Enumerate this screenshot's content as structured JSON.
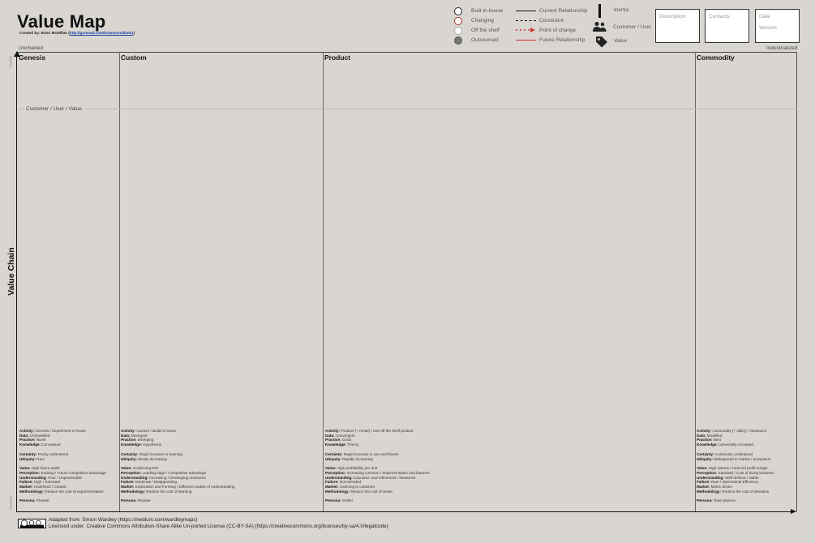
{
  "header": {
    "title": "Value Map",
    "created_by": "Created by: Brian McMillan (",
    "created_link": "http://gonmad.com/brianmcmillan01",
    "created_close": ")"
  },
  "legend": {
    "components": [
      "Built in-house",
      "Changing",
      "Off the shelf",
      "Outsourced"
    ],
    "relationships": [
      "Current Relationship",
      "Constraint",
      "Point of change",
      "Future Relationship"
    ],
    "symbols": [
      "Inertia",
      "Customer / User",
      "Value"
    ]
  },
  "boxes": [
    "Description",
    "Contacts",
    "Date",
    "Version"
  ],
  "evolution": {
    "left": "Uncharted",
    "right": "Industrialized"
  },
  "columns": [
    "Genesis",
    "Custom",
    "Product",
    "Commodity"
  ],
  "axis": {
    "y_label": "Value Chain",
    "visible": "Visible",
    "invisible": "Invisible"
  },
  "customer_line": "Customer / User / Value",
  "column_descriptions": [
    {
      "rows": [
        {
          "k": "Activity:",
          "v": "Genesis / Experiment in house"
        },
        {
          "k": "Data:",
          "v": "Unmodelled"
        },
        {
          "k": "Practice:",
          "v": "Novel"
        },
        {
          "k": "Knowledge:",
          "v": "Conceptual"
        },
        {
          "gap": true
        },
        {
          "k": "Certainty:",
          "v": "Poorly understood"
        },
        {
          "k": "Ubiquity:",
          "v": "Rare"
        },
        {
          "gap": true
        },
        {
          "k": "Value:",
          "v": "High future worth"
        },
        {
          "k": "Perception:",
          "v": "Exciting / Future competitive advantage"
        },
        {
          "k": "Understanding:",
          "v": "Poor / Unpredictable"
        },
        {
          "k": "Failure:",
          "v": "High / Tolerated"
        },
        {
          "k": "Market:",
          "v": "Undefined / Chaotic"
        },
        {
          "k": "Methodology:",
          "v": "Reduce the cost of experimentation"
        },
        {
          "gap": true
        },
        {
          "k": "Persona:",
          "v": "Pioneer"
        }
      ]
    },
    {
      "rows": [
        {
          "k": "Activity:",
          "v": "Custom / Build in house"
        },
        {
          "k": "Data:",
          "v": "Divergent"
        },
        {
          "k": "Practice:",
          "v": "Emerging"
        },
        {
          "k": "Knowledge:",
          "v": "Hypothesis"
        },
        {
          "gap": true
        },
        {
          "k": "Certainty:",
          "v": "Rapid increase in learning"
        },
        {
          "k": "Ubiquity:",
          "v": "Slowly increasing"
        },
        {
          "gap": true
        },
        {
          "k": "Value:",
          "v": "Confirming ROI"
        },
        {
          "k": "Perception:",
          "v": "Leading edge / Competitive advantage"
        },
        {
          "k": "Understanding:",
          "v": "Increasing / Developing measures"
        },
        {
          "k": "Failure:",
          "v": "Moderate / Disappointing"
        },
        {
          "k": "Market:",
          "v": "Exploration and Forming / Different models of understanding"
        },
        {
          "k": "Methodology:",
          "v": "Reduce the cost of learning"
        },
        {
          "gap": true
        },
        {
          "k": "Persona:",
          "v": "Pioneer"
        }
      ]
    },
    {
      "rows": [
        {
          "k": "Activity:",
          "v": "Product (+ rental) / Use off the shelf product"
        },
        {
          "k": "Data:",
          "v": "Convergent"
        },
        {
          "k": "Practice:",
          "v": "Good"
        },
        {
          "k": "Knowledge:",
          "v": "Theory"
        },
        {
          "gap": true
        },
        {
          "k": "Certainty:",
          "v": "Rapid increase in use and fitness"
        },
        {
          "k": "Ubiquity:",
          "v": "Rapidly increasing"
        },
        {
          "gap": true
        },
        {
          "k": "Value:",
          "v": "High profitability per unit"
        },
        {
          "k": "Perception:",
          "v": "Increasing common / Implementation and features"
        },
        {
          "k": "Understanding:",
          "v": "Education and refinement / Measures"
        },
        {
          "k": "Failure:",
          "v": "Not tolerated"
        },
        {
          "k": "Market:",
          "v": "Listening to customer"
        },
        {
          "k": "Methodology:",
          "v": "Reduce the cost of waste"
        },
        {
          "gap": true
        },
        {
          "k": "Persona:",
          "v": "Settler"
        }
      ]
    },
    {
      "rows": [
        {
          "k": "Activity:",
          "v": "Commodity (+ utility) / Outsource"
        },
        {
          "k": "Data:",
          "v": "Modelled"
        },
        {
          "k": "Practice:",
          "v": "Best"
        },
        {
          "k": "Knowledge:",
          "v": "Universally Accepted"
        },
        {
          "gap": true
        },
        {
          "k": "Certainty:",
          "v": "Commonly understood"
        },
        {
          "k": "Ubiquity:",
          "v": "Widespread in market / ecosystem"
        },
        {
          "gap": true
        },
        {
          "k": "Value:",
          "v": "High volume / reduced profit margin"
        },
        {
          "k": "Perception:",
          "v": "Standard / Cost of doing business"
        },
        {
          "k": "Understanding:",
          "v": "Well defined / stable"
        },
        {
          "k": "Failure:",
          "v": "Rare / Operational Efficiency"
        },
        {
          "k": "Market:",
          "v": "Metric driven"
        },
        {
          "k": "Methodology:",
          "v": "Reduce the cost of deviation"
        },
        {
          "gap": true
        },
        {
          "k": "Persona:",
          "v": "Town planner"
        }
      ]
    }
  ],
  "license": {
    "line1": "Adapted from:  Simon Wardley (https://medium.com/wardleymaps)",
    "line2": "Licensed under: Creative Commons Attribution-Share Alike Un-ported License (CC-BY-SA) (https://creativecommons.org/licenses/by-sa/4.0/legalcode)"
  }
}
